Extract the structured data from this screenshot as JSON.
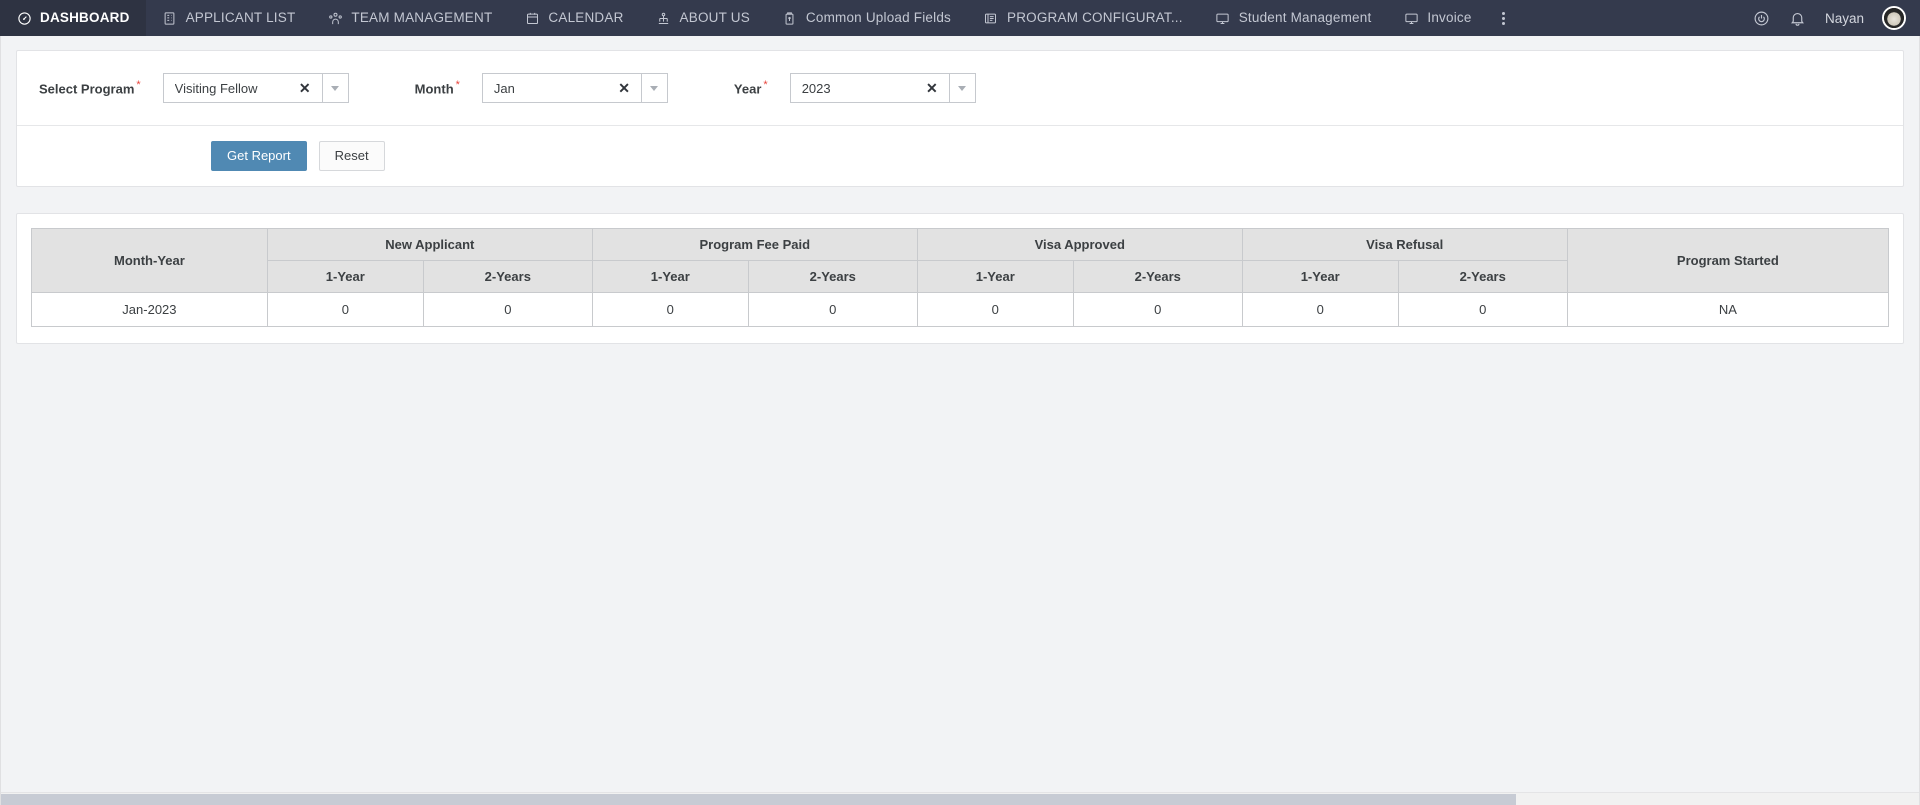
{
  "navbar": {
    "items": [
      {
        "label": "DASHBOARD",
        "icon": "dashboard-gauge-icon",
        "active": true
      },
      {
        "label": "APPLICANT LIST",
        "icon": "list-building-icon",
        "active": false
      },
      {
        "label": "TEAM MANAGEMENT",
        "icon": "team-people-icon",
        "active": false
      },
      {
        "label": "CALENDAR",
        "icon": "calendar-icon",
        "active": false
      },
      {
        "label": "ABOUT US",
        "icon": "about-us-icon",
        "active": false
      },
      {
        "label": "Common Upload Fields",
        "icon": "upload-document-icon",
        "active": false
      },
      {
        "label": "PROGRAM CONFIGURAT...",
        "icon": "program-config-icon",
        "active": false
      },
      {
        "label": "Student Management",
        "icon": "monitor-icon",
        "active": false
      },
      {
        "label": "Invoice",
        "icon": "monitor-icon",
        "active": false
      }
    ],
    "overflow_icon": "kebab-menu-icon",
    "right": {
      "power_icon": "power-icon",
      "notification_icon": "bell-icon",
      "user_name": "Nayan",
      "avatar_icon": "user-avatar"
    },
    "colors": {
      "background": "#343a4d",
      "active_background": "#2e3342",
      "text": "#c3c7d2"
    }
  },
  "filters": {
    "program": {
      "label": "Select Program",
      "required_marker": "*",
      "value": "Visiting Fellow",
      "clear_icon": "✕",
      "dropdown_icon": "chevron-down-icon"
    },
    "month": {
      "label": "Month",
      "required_marker": "*",
      "value": "Jan",
      "clear_icon": "✕",
      "dropdown_icon": "chevron-down-icon"
    },
    "year": {
      "label": "Year",
      "required_marker": "*",
      "value": "2023",
      "clear_icon": "✕",
      "dropdown_icon": "chevron-down-icon"
    }
  },
  "actions": {
    "get_report_label": "Get Report",
    "reset_label": "Reset",
    "primary_color": "#5089b3"
  },
  "table": {
    "group_headers": [
      {
        "label": "Month-Year",
        "colspan": 1,
        "rowspan": 2
      },
      {
        "label": "New Applicant",
        "colspan": 2,
        "rowspan": 1
      },
      {
        "label": "Program Fee Paid",
        "colspan": 2,
        "rowspan": 1
      },
      {
        "label": "Visa Approved",
        "colspan": 2,
        "rowspan": 1
      },
      {
        "label": "Visa Refusal",
        "colspan": 2,
        "rowspan": 1
      },
      {
        "label": "Program Started",
        "colspan": 1,
        "rowspan": 2
      }
    ],
    "sub_headers": [
      "1-Year",
      "2-Years",
      "1-Year",
      "2-Years",
      "1-Year",
      "2-Years",
      "1-Year",
      "2-Years"
    ],
    "rows": [
      {
        "month_year": "Jan-2023",
        "new_applicant_1y": "0",
        "new_applicant_2y": "0",
        "program_fee_paid_1y": "0",
        "program_fee_paid_2y": "0",
        "visa_approved_1y": "0",
        "visa_approved_2y": "0",
        "visa_refusal_1y": "0",
        "visa_refusal_2y": "0",
        "program_started": "NA"
      }
    ]
  }
}
